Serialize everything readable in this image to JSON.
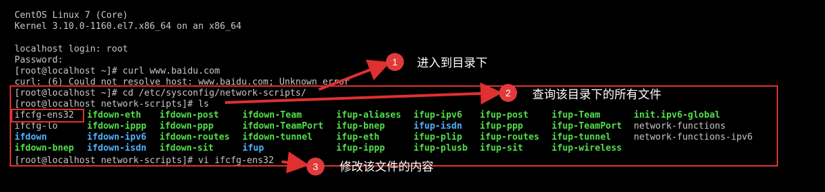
{
  "terminal": {
    "line1": "CentOS Linux 7 (Core)",
    "line2": "Kernel 3.10.0-1160.el7.x86_64 on an x86_64",
    "line3": "localhost login: root",
    "line4": "Password:",
    "line5": "[root@localhost ~]# curl www.baidu.com",
    "line6": "curl: (6) Could not resolve host: www.baidu.com; Unknown error",
    "line7": "[root@localhost ~]# cd /etc/sysconfig/network-scripts/",
    "line8": "[root@localhost network-scripts]# ls",
    "line_last": "[root@localhost network-scripts]# vi ifcfg-ens32"
  },
  "ls_output": {
    "row1": [
      "ifcfg-ens32",
      "ifdown-eth",
      "ifdown-post",
      "ifdown-Team",
      "ifup-aliases",
      "ifup-ipv6",
      "ifup-post",
      "ifup-Team",
      "init.ipv6-global"
    ],
    "row2": [
      "ifcfg-lo",
      "ifdown-ippp",
      "ifdown-ppp",
      "ifdown-TeamPort",
      "ifup-bnep",
      "ifup-isdn",
      "ifup-ppp",
      "ifup-TeamPort",
      "network-functions"
    ],
    "row3": [
      "ifdown",
      "ifdown-ipv6",
      "ifdown-routes",
      "ifdown-tunnel",
      "ifup-eth",
      "ifup-plip",
      "ifup-routes",
      "ifup-tunnel",
      "network-functions-ipv6"
    ],
    "row4": [
      "ifdown-bnep",
      "ifdown-isdn",
      "ifdown-sit",
      "ifup",
      "ifup-ippp",
      "ifup-plusb",
      "ifup-sit",
      "ifup-wireless"
    ]
  },
  "annotations": {
    "n1": "1",
    "t1": "进入到目录下",
    "n2": "2",
    "t2": "查询该目录下的所有文件",
    "n3": "3",
    "t3": "修改该文件的内容"
  },
  "colors": {
    "green": "#52e04a",
    "cyan": "#4fb3ff",
    "red": "#e03030",
    "text": "#c8c8c8"
  }
}
